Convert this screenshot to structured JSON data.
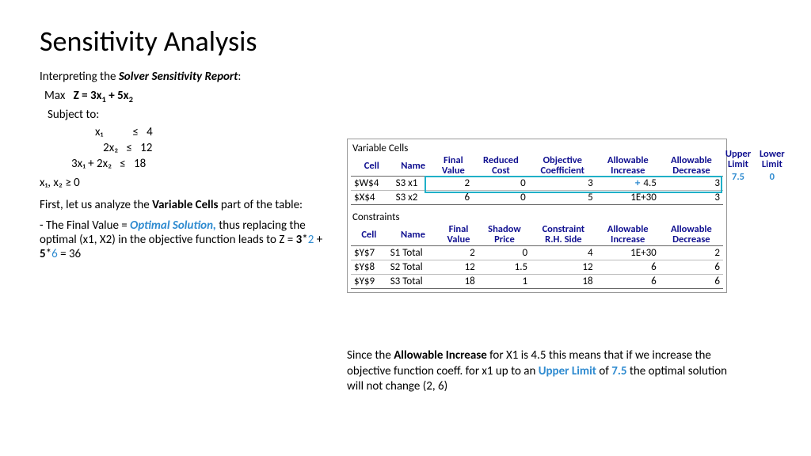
{
  "title": "Sensitivity Analysis",
  "intro_prefix": "Interpreting the ",
  "intro_bold": "Solver Sensitivity Report",
  "intro_suffix": ":",
  "objective": {
    "max": "Max",
    "eq_prefix": "Z = 3x",
    "eq_mid": " + 5x"
  },
  "subject_to": "Subject to:",
  "constraints": {
    "c1": "x₁           ≤   4",
    "c2": "   2x₂   ≤   12",
    "c3": "3x₁ + 2x₂   ≤   18"
  },
  "nonneg": "x₁, x₂ ≥ 0",
  "analysis1_prefix": "First, let us analyze the ",
  "analysis1_bold": "Variable Cells",
  "analysis1_suffix": " part of the table:",
  "analysis2_prefix": "- The Final Value = ",
  "analysis2_opt": "Optimal Solution,",
  "analysis2_mid": " thus replacing the optimal (x1, X2) in the objective function leads to Z = ",
  "analysis2_b1": "3",
  "analysis2_star1": "*",
  "analysis2_n1": "2",
  "analysis2_plus": " + ",
  "analysis2_b2": "5",
  "analysis2_star2": "*",
  "analysis2_n2": "6",
  "analysis2_eq": " = 36",
  "report": {
    "var_title": "Variable Cells",
    "var_headers": [
      "Cell",
      "Name",
      "Final Value",
      "Reduced Cost",
      "Objective Coefficient",
      "Allowable Increase",
      "Allowable Decrease"
    ],
    "var_rows": [
      {
        "cell": "$W$4",
        "name": "S3 x1",
        "fv": "2",
        "rc": "0",
        "oc": "3",
        "plus": "+",
        "ai": "4.5",
        "ad": "3"
      },
      {
        "cell": "$X$4",
        "name": "S3 x2",
        "fv": "6",
        "rc": "0",
        "oc": "5",
        "plus": "",
        "ai": "1E+30",
        "ad": "3"
      }
    ],
    "con_title": "Constraints",
    "con_headers": [
      "Cell",
      "Name",
      "Final Value",
      "Shadow Price",
      "Constraint R.H. Side",
      "Allowable Increase",
      "Allowable Decrease"
    ],
    "con_rows": [
      {
        "cell": "$Y$7",
        "name": "S1 Total",
        "fv": "2",
        "sp": "0",
        "rhs": "4",
        "ai": "1E+30",
        "ad": "2"
      },
      {
        "cell": "$Y$8",
        "name": "S2 Total",
        "fv": "12",
        "sp": "1.5",
        "rhs": "12",
        "ai": "6",
        "ad": "6"
      },
      {
        "cell": "$Y$9",
        "name": "S3 Total",
        "fv": "18",
        "sp": "1",
        "rhs": "18",
        "ai": "6",
        "ad": "6"
      }
    ]
  },
  "limits": {
    "upper_h1": "Upper",
    "upper_h2": "Limit",
    "lower_h1": "Lower",
    "lower_h2": "Limit",
    "upper_val": "7.5",
    "lower_val": "0"
  },
  "explain": {
    "p1": "Since the ",
    "b1": "Allowable Increase",
    "p2": " for X1 is 4.5 this means that if we increase the objective function coeff.  for x1 up to an ",
    "l1": "Upper Limit",
    "p3": " of ",
    "l2": "7.5",
    "p4": " the optimal solution will not change  (2, 6)"
  }
}
